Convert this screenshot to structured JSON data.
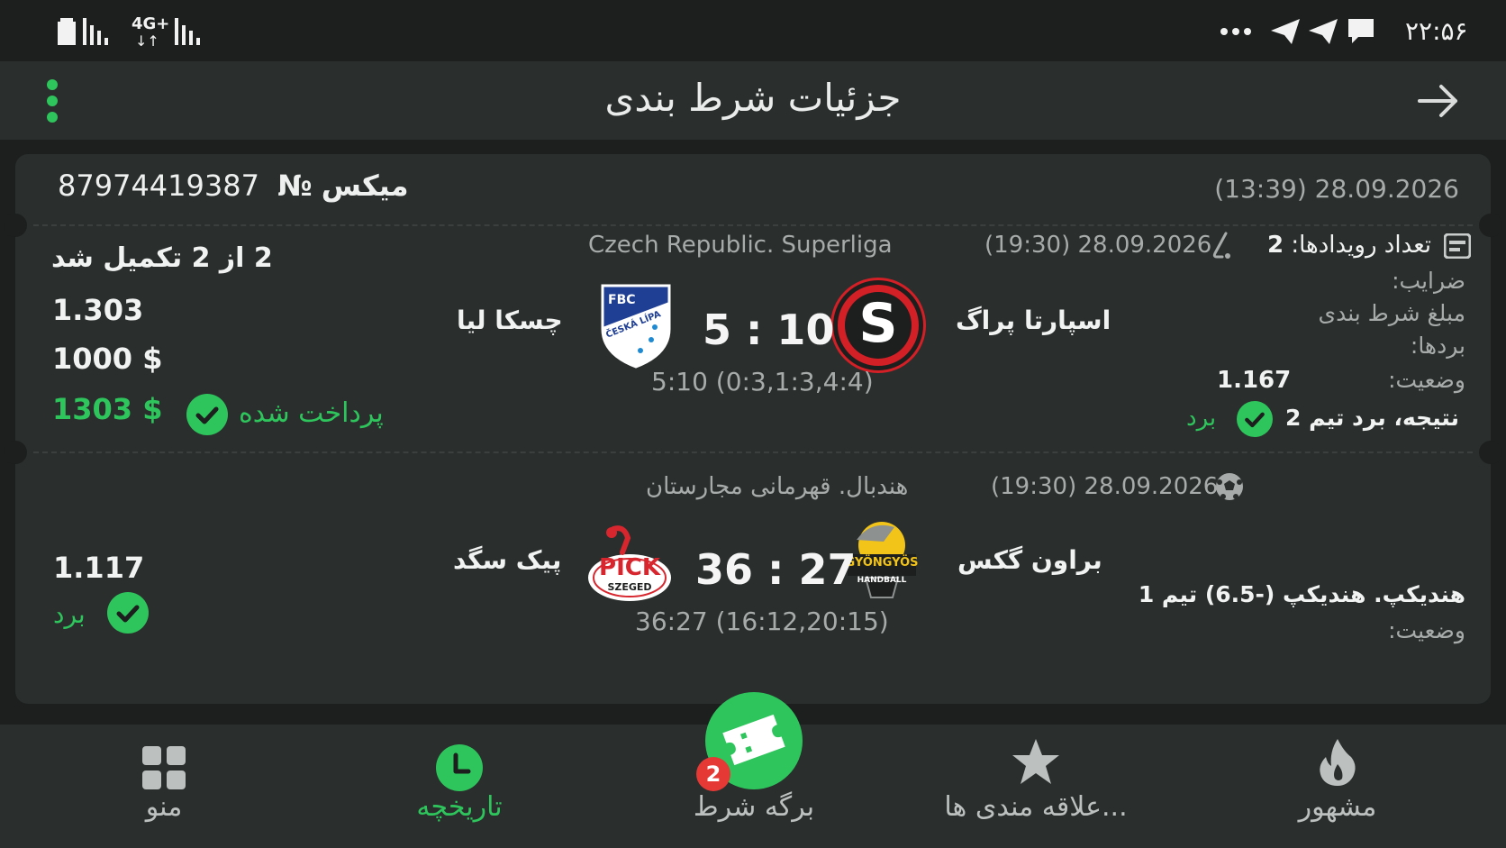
{
  "status_bar": {
    "time": "۲۲:۵۶",
    "network": "4G+",
    "icons": [
      "battery-icon",
      "signal-icon",
      "signal-icon",
      "more-dots-icon",
      "telegram-icon",
      "telegram-icon",
      "message-icon"
    ]
  },
  "header": {
    "title": "جزئیات شرط بندی",
    "menu_icon": "vertical-dots-icon",
    "back_icon": "arrow-right-icon"
  },
  "bet": {
    "type_label": "میکس",
    "number_symbol": "№",
    "number": "87974419387",
    "datetime": "(13:39) 28.09.2026",
    "events_label": "تعداد رویدادها:",
    "events_count": "2",
    "completed_text": "2 از 2 تکمیل شد",
    "odds_label": "ضرایب:",
    "odds_value": "1.303",
    "stake_label": "مبلغ شرط بندی",
    "stake_value": "1000 $",
    "wins_label": "بردها:",
    "wins_value": "1303 $",
    "paid_text": "پرداخت شده"
  },
  "events": [
    {
      "datetime": "(19:30) 28.09.2026",
      "sport_icon": "floorball-icon",
      "league": "Czech Republic. Superliga",
      "home_team": "اسپارتا پراگ",
      "away_team": "چسکا لیا",
      "home_logo_letter": "S",
      "away_logo_text": "FBC",
      "away_logo_subtext": "ČESKÁ LÍPA",
      "score": "5 : 10",
      "score_detail": "5:10 (0:3,1:3,4:4)",
      "odds": "1.167",
      "status_label": "وضعیت:",
      "market": "نتیجه، برد تیم 2",
      "result": "برد"
    },
    {
      "datetime": "(19:30) 28.09.2026",
      "sport_icon": "handball-icon",
      "league": "هندبال. قهرمانی مجارستان",
      "home_team": "براون گکس",
      "away_team": "پیک سگد",
      "home_logo_text": "GYÖNGYÖS",
      "home_logo_subtext": "HANDBALL",
      "away_logo_text": "PICK",
      "away_logo_subtext": "SZEGED",
      "score": "36 : 27",
      "score_detail": "36:27 (16:12,20:15)",
      "odds": "1.117",
      "status_label": "وضعیت:",
      "market": "هندیکپ. هندیکپ (-6.5) تیم 1",
      "result": "برد"
    }
  ],
  "bottom_nav": {
    "items": [
      {
        "label": "مشهور",
        "icon": "flame-icon"
      },
      {
        "label": "علاقه مندی ها...",
        "icon": "star-icon"
      },
      {
        "label": "برگه شرط",
        "icon": "ticket-icon",
        "badge": "2"
      },
      {
        "label": "تاریخچه",
        "icon": "clock-icon"
      },
      {
        "label": "منو",
        "icon": "grid-icon"
      }
    ]
  },
  "colors": {
    "accent": "#2ec55c",
    "background": "#1c1f1e",
    "surface": "#2a2e2d",
    "badge": "#e53935",
    "muted_text": "#a7acaa"
  }
}
